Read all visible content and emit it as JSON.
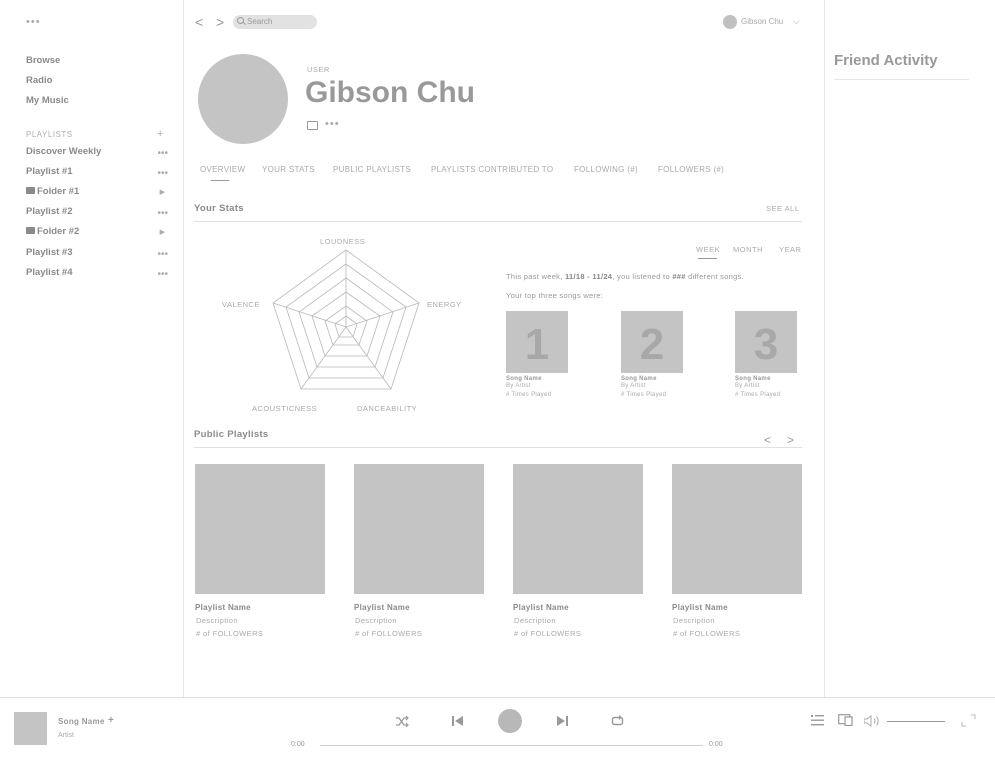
{
  "sidebar": {
    "nav": [
      {
        "label": "Browse"
      },
      {
        "label": "Radio"
      },
      {
        "label": "My Music"
      }
    ],
    "playlists_header": "PLAYLISTS",
    "add_symbol": "+",
    "playlists": [
      {
        "label": "Discover Weekly",
        "kind": "playlist"
      },
      {
        "label": "Playlist #1",
        "kind": "playlist"
      },
      {
        "label": "Folder #1",
        "kind": "folder"
      },
      {
        "label": "Playlist #2",
        "kind": "playlist"
      },
      {
        "label": "Folder #2",
        "kind": "folder"
      },
      {
        "label": "Playlist #3",
        "kind": "playlist"
      },
      {
        "label": "Playlist #4",
        "kind": "playlist"
      }
    ]
  },
  "topbar": {
    "back_glyph": "<",
    "forward_glyph": ">",
    "search_placeholder": "Search",
    "user_name": "Gibson Chu"
  },
  "profile": {
    "type_label": "USER",
    "name": "Gibson Chu"
  },
  "tabs": [
    {
      "label": "OVERVIEW",
      "active": true
    },
    {
      "label": "YOUR STATS"
    },
    {
      "label": "PUBLIC PLAYLISTS"
    },
    {
      "label": "PLAYLISTS CONTRIBUTED TO"
    },
    {
      "label": "FOLLOWING (#)"
    },
    {
      "label": "FOLLOWERS (#)"
    }
  ],
  "stats": {
    "title": "Your Stats",
    "see_all": "SEE ALL",
    "radar_axes": [
      "LOUDNESS",
      "ENERGY",
      "DANCEABILITY",
      "ACOUSTICNESS",
      "VALENCE"
    ],
    "periods": [
      {
        "label": "WEEK",
        "active": true
      },
      {
        "label": "MONTH"
      },
      {
        "label": "YEAR"
      }
    ],
    "summary_prefix": "This past week, ",
    "summary_range": "11/18 - 11/24",
    "summary_mid": ", you listened to ",
    "summary_count": "###",
    "summary_suffix": " different songs.",
    "top_three_label": "Your top three songs were:",
    "top_songs": [
      {
        "rank": "1",
        "name": "Song Name",
        "artist": "By Artist",
        "plays": "# Times Played"
      },
      {
        "rank": "2",
        "name": "Song Name",
        "artist": "By Artist",
        "plays": "# Times Played"
      },
      {
        "rank": "3",
        "name": "Song Name",
        "artist": "By Artist",
        "plays": "# Times Played"
      }
    ]
  },
  "public_playlists": {
    "title": "Public Playlists",
    "prev_glyph": "<",
    "next_glyph": ">",
    "items": [
      {
        "name": "Playlist Name",
        "description": "Description",
        "followers": "# of FOLLOWERS"
      },
      {
        "name": "Playlist Name",
        "description": "Description",
        "followers": "# of FOLLOWERS"
      },
      {
        "name": "Playlist Name",
        "description": "Description",
        "followers": "# of FOLLOWERS"
      },
      {
        "name": "Playlist Name",
        "description": "Description",
        "followers": "# of FOLLOWERS"
      }
    ]
  },
  "friend_activity": {
    "title": "Friend Activity"
  },
  "player": {
    "song_name": "Song Name",
    "add_symbol": "+",
    "artist": "Artist",
    "time_elapsed": "0:00",
    "time_total": "0:00"
  },
  "colors": {
    "placeholder_gray": "#c4c4c4",
    "text_gray": "#8a8a8a",
    "divider": "#e0e0e0"
  }
}
